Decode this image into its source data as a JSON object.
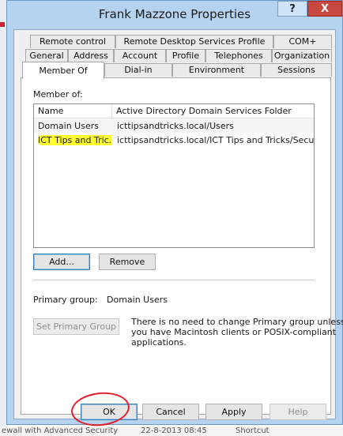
{
  "window": {
    "title": "Frank Mazzone Properties",
    "help_glyph": "?",
    "close_glyph": "X"
  },
  "tabs": {
    "row1": [
      "Remote control",
      "Remote Desktop Services Profile",
      "COM+"
    ],
    "row2": [
      "General",
      "Address",
      "Account",
      "Profile",
      "Telephones",
      "Organization"
    ],
    "row3": [
      "Member Of",
      "Dial-in",
      "Environment",
      "Sessions"
    ],
    "active": "Member Of"
  },
  "member_of": {
    "label": "Member of:",
    "columns": [
      "Name",
      "Active Directory Domain Services Folder"
    ],
    "rows": [
      {
        "name": "Domain Users",
        "folder": "icttipsandtricks.local/Users"
      },
      {
        "name": "ICT Tips and Tric...",
        "folder": "icttipsandtricks.local/ICT Tips and Tricks/Securit..."
      }
    ],
    "highlight_color": "#ffff2e"
  },
  "buttons": {
    "add": "Add...",
    "remove": "Remove",
    "set_primary": "Set Primary Group"
  },
  "primary_group": {
    "label": "Primary group:",
    "value": "Domain Users",
    "note_lines": [
      "There is no need to change Primary group unless",
      "you have Macintosh clients or POSIX-compliant",
      "applications."
    ]
  },
  "footer": {
    "ok": "OK",
    "cancel": "Cancel",
    "apply": "Apply",
    "help": "Help"
  },
  "background_app": {
    "text_1": "ewall with Advanced Security",
    "text_2": "22-8-2013 08:45",
    "text_3": "Shortcut"
  },
  "colors": {
    "title_bar": "#b5d3ef",
    "close_button": "#c7483f",
    "annotation_circle": "#e0202c"
  }
}
